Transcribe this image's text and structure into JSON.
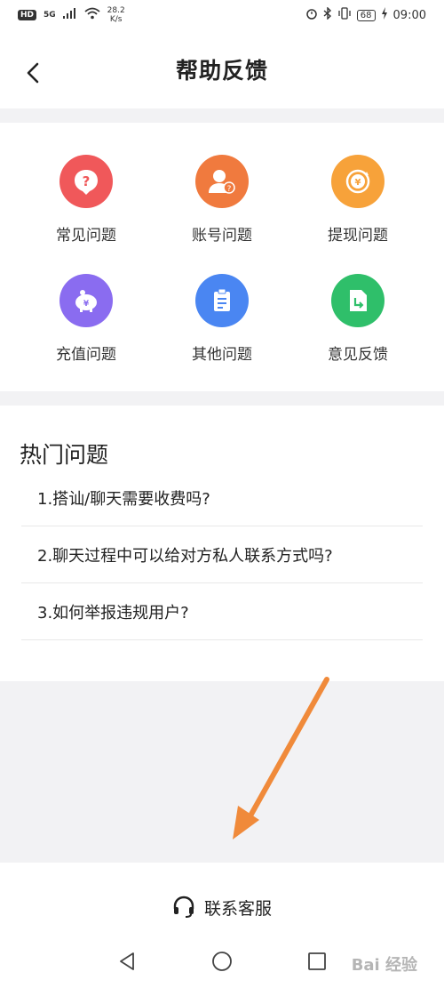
{
  "status_bar": {
    "hd": "HD",
    "signal": "5G",
    "net_speed_value": "28.2",
    "net_speed_unit": "K/s",
    "battery": "68",
    "time": "09:00"
  },
  "header": {
    "title": "帮助反馈"
  },
  "categories": [
    {
      "label": "常见问题",
      "icon": "question-icon",
      "color": "#f0585a"
    },
    {
      "label": "账号问题",
      "icon": "account-icon",
      "color": "#f07a3e"
    },
    {
      "label": "提现问题",
      "icon": "withdraw-icon",
      "color": "#f7a23a"
    },
    {
      "label": "充值问题",
      "icon": "piggy-bank-icon",
      "color": "#8a6cf0"
    },
    {
      "label": "其他问题",
      "icon": "clipboard-icon",
      "color": "#4a86f2"
    },
    {
      "label": "意见反馈",
      "icon": "feedback-doc-icon",
      "color": "#2fbf6a"
    }
  ],
  "hot": {
    "title": "热门问题",
    "items": [
      "1.搭讪/聊天需要收费吗?",
      "2.聊天过程中可以给对方私人联系方式吗?",
      "3.如何举报违规用户?"
    ]
  },
  "contact": {
    "label": "联系客服"
  },
  "watermark": "Bai 经验",
  "colors": {
    "arrow": "#f08a3a"
  }
}
